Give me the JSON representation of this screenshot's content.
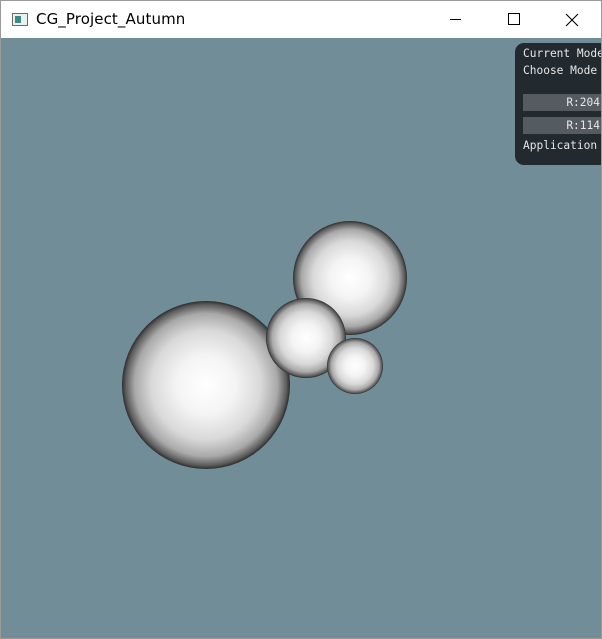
{
  "window": {
    "title": "CG_Project_Autumn",
    "controls": {
      "minimize_icon": "minimize-icon",
      "maximize_icon": "maximize-icon",
      "close_icon": "close-icon"
    }
  },
  "viewport": {
    "background_color": "#718d98",
    "spheres": [
      {
        "name": "large-sphere"
      },
      {
        "name": "upper-right-sphere"
      },
      {
        "name": "middle-sphere"
      },
      {
        "name": "small-sphere"
      }
    ]
  },
  "gui": {
    "current_mode_label": "Current Mode",
    "choose_mode_label": "Choose Mode",
    "field_1_value": "R:204",
    "field_2_value": "R:114",
    "application_label": "Application"
  }
}
